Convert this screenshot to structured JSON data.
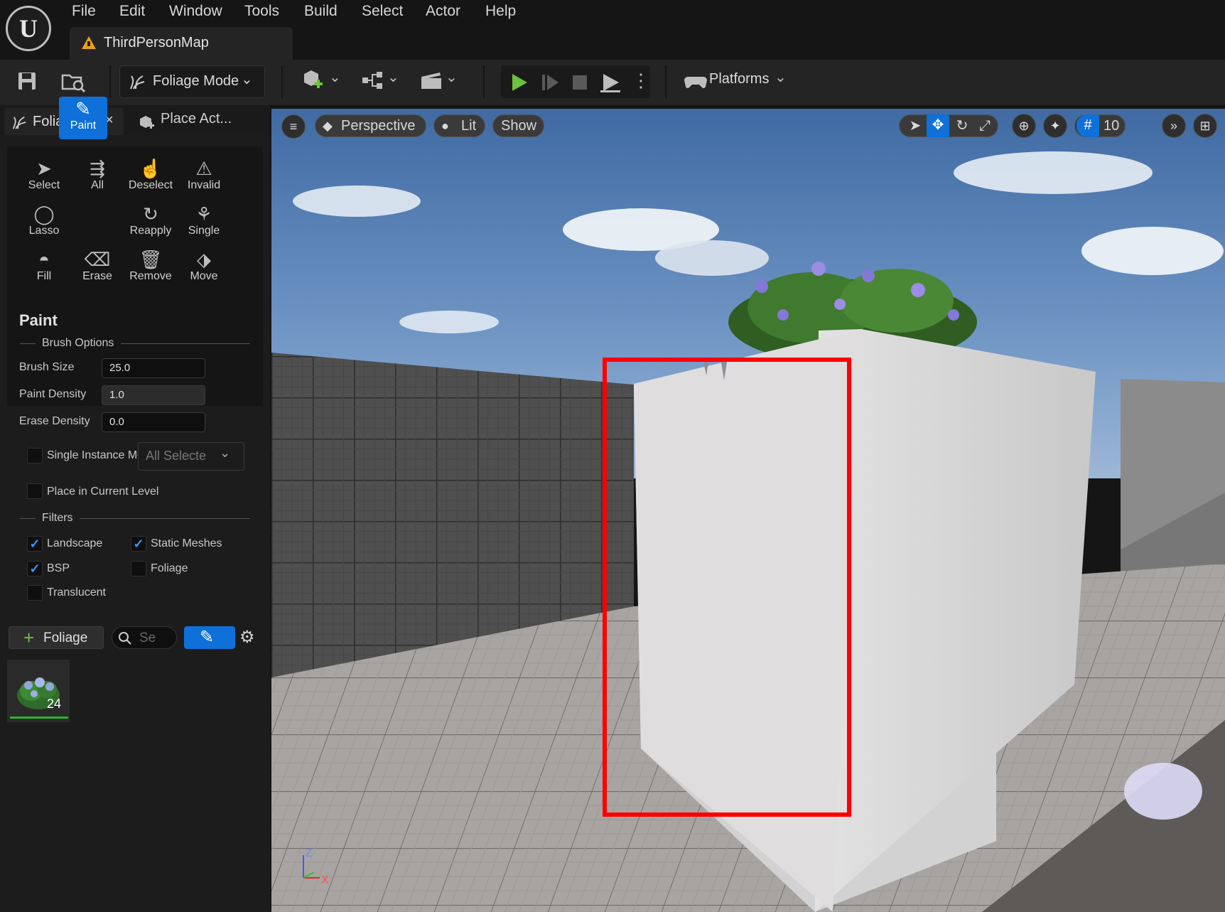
{
  "menu": [
    "File",
    "Edit",
    "Window",
    "Tools",
    "Build",
    "Select",
    "Actor",
    "Help"
  ],
  "doc_tab": {
    "title": "ThirdPersonMap"
  },
  "toolbar": {
    "mode_label": "Foliage Mode",
    "platforms_label": "Platforms"
  },
  "panel_tabs": {
    "foliage": "Foliage",
    "place_actors": "Place Act..."
  },
  "tools": [
    {
      "label": "Select",
      "icon": "cursor-icon"
    },
    {
      "label": "All",
      "icon": "select-all-icon"
    },
    {
      "label": "Deselect",
      "icon": "deselect-icon"
    },
    {
      "label": "Invalid",
      "icon": "invalid-icon"
    },
    {
      "label": "Lasso",
      "icon": "lasso-icon"
    },
    {
      "label": "Paint",
      "icon": "paint-brush-icon",
      "active": true
    },
    {
      "label": "Reapply",
      "icon": "reapply-icon"
    },
    {
      "label": "Single",
      "icon": "single-icon"
    },
    {
      "label": "Fill",
      "icon": "fill-icon"
    },
    {
      "label": "Erase",
      "icon": "erase-icon"
    },
    {
      "label": "Remove",
      "icon": "trash-icon"
    },
    {
      "label": "Move",
      "icon": "move-icon"
    }
  ],
  "paint": {
    "title": "Paint",
    "brush_options": "Brush Options",
    "brush_size_label": "Brush Size",
    "brush_size": "25.0",
    "paint_density_label": "Paint Density",
    "paint_density": "1.0",
    "erase_density_label": "Erase Density",
    "erase_density": "0.0",
    "single_instance_label": "Single Instance Mode",
    "single_instance_dropdown": "All Selecte",
    "place_current_level_label": "Place in Current Level",
    "filters_label": "Filters",
    "filters": {
      "landscape": {
        "label": "Landscape",
        "checked": true
      },
      "static_meshes": {
        "label": "Static Meshes",
        "checked": true
      },
      "bsp": {
        "label": "BSP",
        "checked": true
      },
      "foliage": {
        "label": "Foliage",
        "checked": false
      },
      "translucent": {
        "label": "Translucent",
        "checked": false
      }
    }
  },
  "foliage_list": {
    "add_label": "Foliage",
    "search_placeholder": "Se",
    "item_count": "24"
  },
  "viewport": {
    "perspective_label": "Perspective",
    "lit_label": "Lit",
    "show_label": "Show",
    "grid_snap": "10",
    "axis_z": "Z",
    "axis_x": "X"
  },
  "colors": {
    "accent": "#0e70d8",
    "play": "#6cc23b",
    "highlight_box": "#ff0000"
  }
}
